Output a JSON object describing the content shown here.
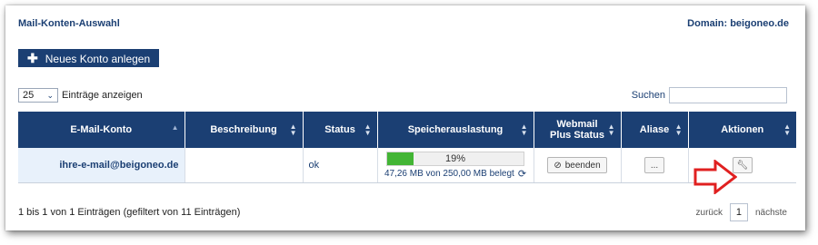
{
  "header": {
    "title": "Mail-Konten-Auswahl",
    "domain": "Domain: beigoneo.de"
  },
  "toolbar": {
    "new_account_label": "Neues Konto anlegen"
  },
  "length_menu": {
    "value": "25",
    "label": "Einträge anzeigen"
  },
  "search": {
    "label": "Suchen",
    "value": "",
    "placeholder": ""
  },
  "table": {
    "columns": [
      "E-Mail-Konto",
      "Beschreibung",
      "Status",
      "Speicherauslastung",
      "Webmail Plus Status",
      "Aliase",
      "Aktionen"
    ],
    "rows": [
      {
        "email": "ihre-e-mail@beigoneo.de",
        "description": "",
        "status": "ok",
        "storage_percent": 19,
        "storage_percent_label": "19%",
        "storage_text": "47,26 MB von 250,00 MB belegt",
        "webmail_button": "beenden",
        "alias_button": "...",
        "action_icon": "wrench-icon"
      }
    ]
  },
  "footer": {
    "info": "1 bis 1 von 1 Einträgen (gefiltert von 11 Einträgen)",
    "prev": "zurück",
    "page": "1",
    "next": "nächste"
  },
  "colors": {
    "header_bg": "#1b3f73",
    "progress": "#43b535",
    "arrow": "#e02020",
    "email_bg": "#e8f1fb"
  }
}
